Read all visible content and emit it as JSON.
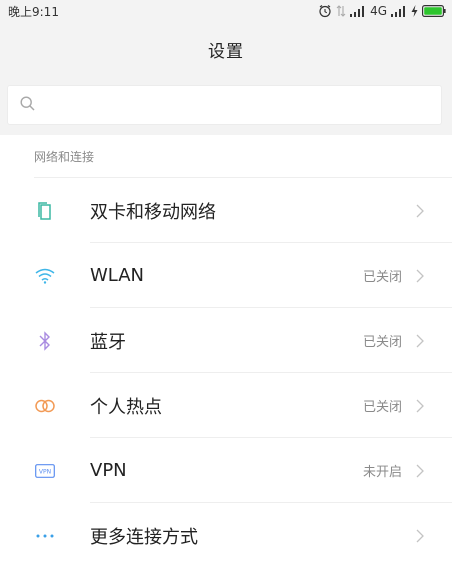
{
  "status_bar": {
    "time": "晚上9:11",
    "network_label": "4G"
  },
  "header": {
    "title": "设置"
  },
  "search": {
    "placeholder": ""
  },
  "section": {
    "title": "网络和连接"
  },
  "items": [
    {
      "label": "双卡和移动网络",
      "status": "",
      "icon": "sim-card-icon",
      "color": "#3cb8a4"
    },
    {
      "label": "WLAN",
      "status": "已关闭",
      "icon": "wifi-icon",
      "color": "#3fb6e8"
    },
    {
      "label": "蓝牙",
      "status": "已关闭",
      "icon": "bluetooth-icon",
      "color": "#a98be0"
    },
    {
      "label": "个人热点",
      "status": "已关闭",
      "icon": "hotspot-icon",
      "color": "#f29a55"
    },
    {
      "label": "VPN",
      "status": "未开启",
      "icon": "vpn-icon",
      "color": "#5d8ff0"
    },
    {
      "label": "更多连接方式",
      "status": "",
      "icon": "more-icon",
      "color": "#3aa0e8"
    }
  ],
  "colors": {
    "battery": "#2ec52e",
    "chevron": "#c4c4c4"
  }
}
